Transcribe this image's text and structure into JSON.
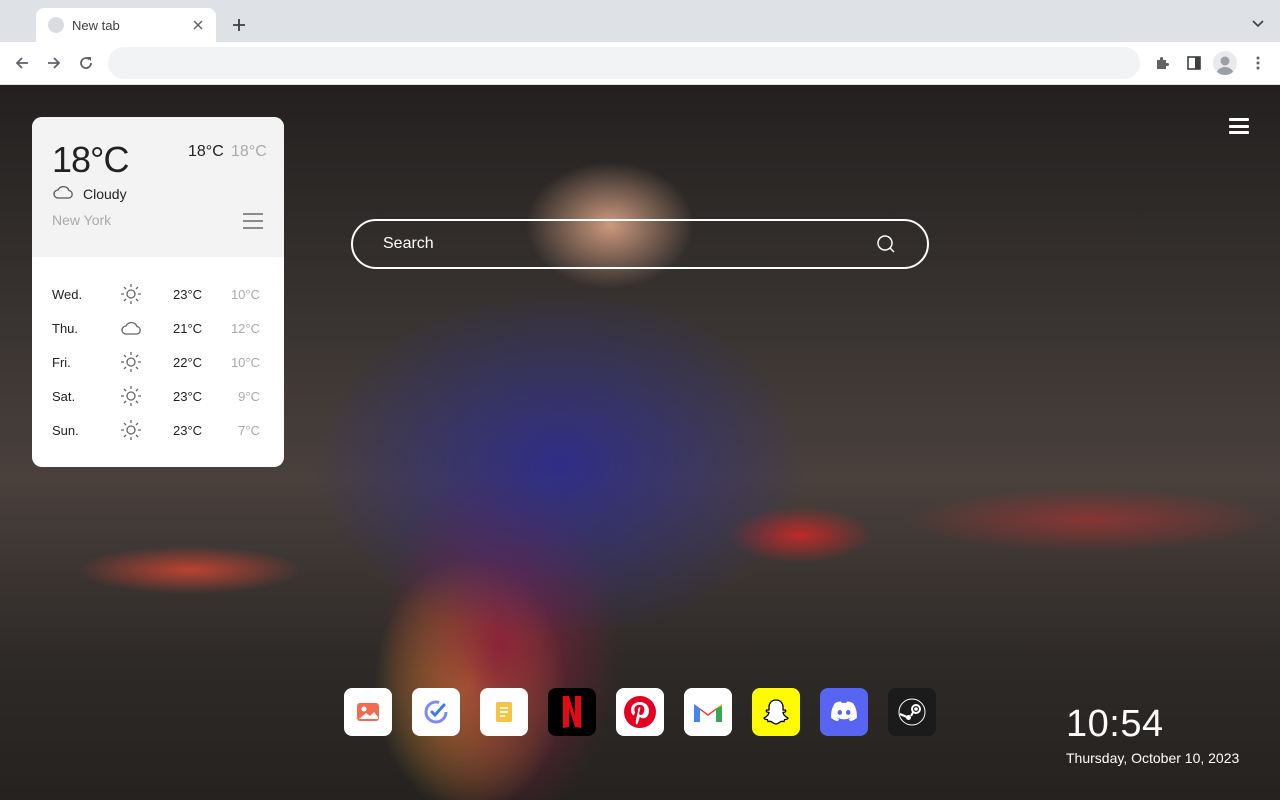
{
  "browser": {
    "tab_title": "New tab",
    "address_value": "",
    "address_placeholder": ""
  },
  "weather": {
    "current_temp": "18°C",
    "high": "18°C",
    "low": "18°C",
    "condition": "Cloudy",
    "condition_icon": "cloud-icon",
    "city": "New York",
    "forecast": [
      {
        "day": "Wed.",
        "icon": "sun-icon",
        "high": "23°C",
        "low": "10°C"
      },
      {
        "day": "Thu.",
        "icon": "cloud-icon",
        "high": "21°C",
        "low": "12°C"
      },
      {
        "day": "Fri.",
        "icon": "sun-icon",
        "high": "22°C",
        "low": "10°C"
      },
      {
        "day": "Sat.",
        "icon": "sun-icon",
        "high": "23°C",
        "low": "9°C"
      },
      {
        "day": "Sun.",
        "icon": "sun-icon",
        "high": "23°C",
        "low": "7°C"
      }
    ]
  },
  "search": {
    "placeholder": "Search",
    "value": ""
  },
  "dock": {
    "apps": [
      {
        "name": "photos",
        "icon": "image-icon",
        "bg": "#ffffff"
      },
      {
        "name": "tasks",
        "icon": "check-icon",
        "bg": "#ffffff"
      },
      {
        "name": "notes",
        "icon": "note-icon",
        "bg": "#ffffff"
      },
      {
        "name": "netflix",
        "icon": "netflix-icon",
        "bg": "#000000"
      },
      {
        "name": "pinterest",
        "icon": "pinterest-icon",
        "bg": "#ffffff"
      },
      {
        "name": "gmail",
        "icon": "gmail-icon",
        "bg": "#ffffff"
      },
      {
        "name": "snapchat",
        "icon": "snapchat-icon",
        "bg": "#fffc00"
      },
      {
        "name": "discord",
        "icon": "discord-icon",
        "bg": "#5865f2"
      },
      {
        "name": "steam",
        "icon": "steam-icon",
        "bg": "#1b1b1b"
      }
    ]
  },
  "clock": {
    "time": "10:54",
    "date": "Thursday, October 10, 2023"
  },
  "colors": {
    "chrome_bg": "#dee1e6",
    "omnibox_bg": "#f1f3f4",
    "weather_top_bg": "#f3f3f3"
  }
}
